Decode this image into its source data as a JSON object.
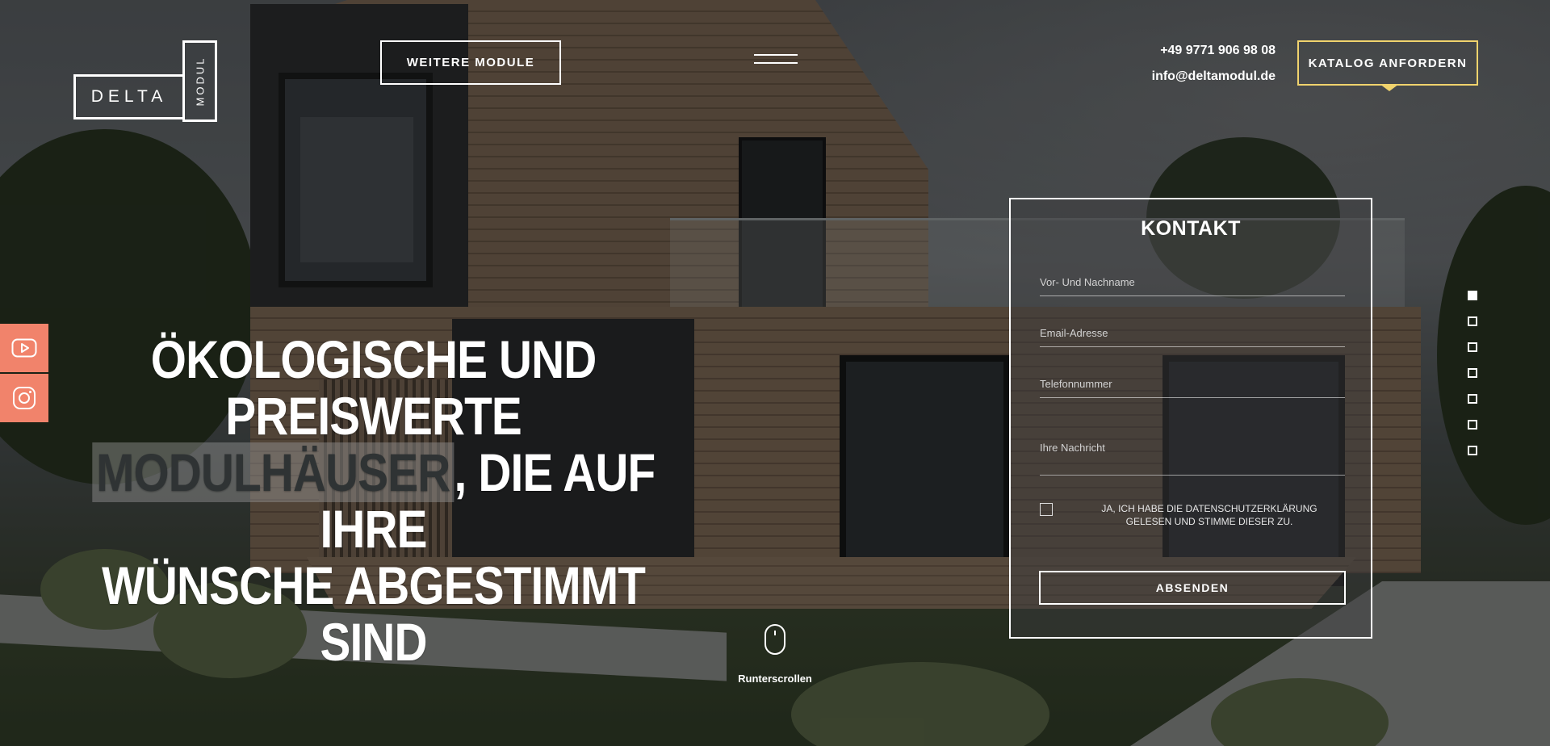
{
  "brand": {
    "logo_main": "DELTA",
    "logo_side": "MODUL"
  },
  "header": {
    "more_modules": "WEITERE MODULE",
    "phone": "+49 9771 906 98 08",
    "email": "info@deltamodul.de",
    "catalog": "KATALOG ANFORDERN"
  },
  "hero": {
    "line1": "ÖKOLOGISCHE UND PREISWERTE",
    "highlight": "MODULHÄUSER",
    "line2_rest": ", DIE AUF IHRE",
    "line3": "WÜNSCHE ABGESTIMMT SIND"
  },
  "form": {
    "title": "KONTAKT",
    "name_placeholder": "Vor- Und Nachname",
    "email_placeholder": "Email-Adresse",
    "phone_placeholder": "Telefonnummer",
    "message_placeholder": "Ihre Nachricht",
    "consent": "JA, ICH HABE DIE DATENSCHUTZERKLÄRUNG GELESEN UND STIMME DIESER ZU.",
    "submit": "ABSENDEN"
  },
  "scroll": {
    "label": "Runterscrollen"
  },
  "colors": {
    "social_bg": "#f1836b",
    "catalog_border": "#f0d36d"
  },
  "icons": {
    "youtube": "youtube-icon",
    "instagram": "instagram-icon"
  },
  "pagination": {
    "count": 7,
    "active_index": 0
  }
}
